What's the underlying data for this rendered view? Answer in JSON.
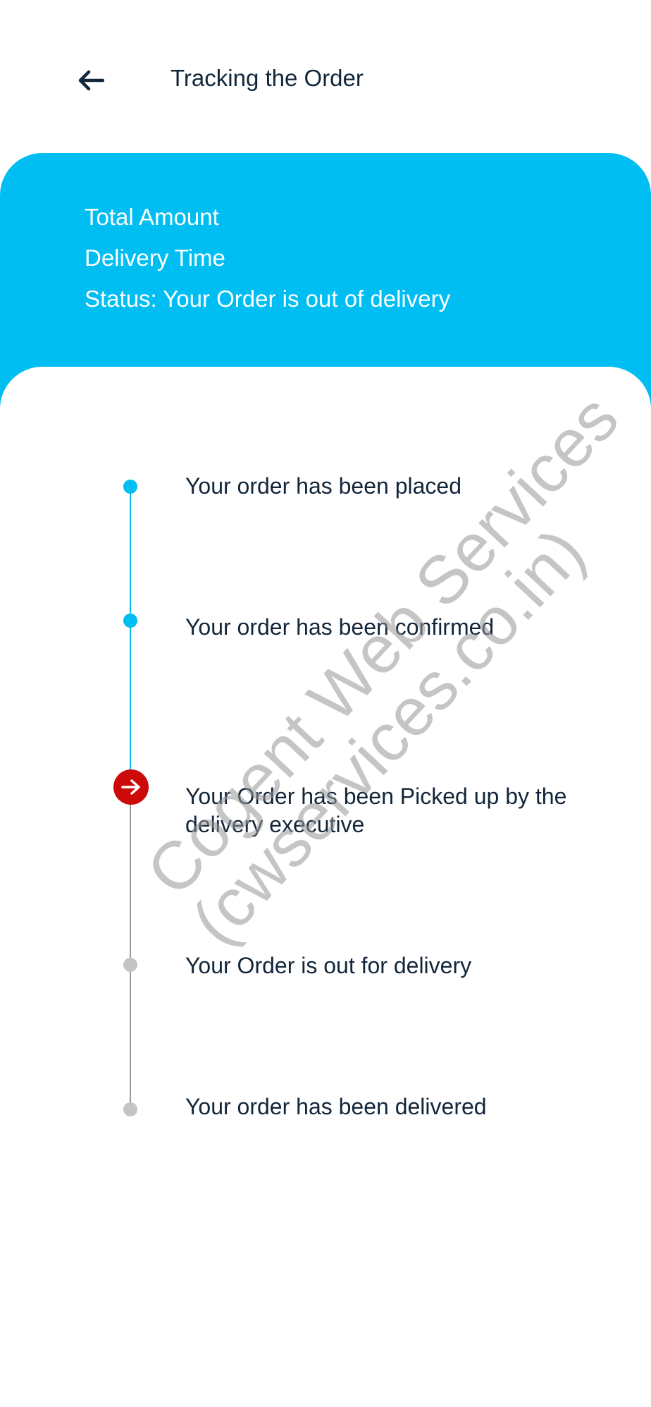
{
  "header": {
    "back_icon": "arrow-left-icon",
    "title": "Tracking the Order"
  },
  "summary": {
    "total_amount_label": "Total Amount",
    "delivery_time_label": "Delivery Time",
    "status_text": "Status: Your Order is out of delivery"
  },
  "timeline": {
    "steps": [
      {
        "label": "Your order has been placed",
        "state": "done"
      },
      {
        "label": "Your order has been confirmed",
        "state": "done"
      },
      {
        "label": "Your Order has been Picked up by the delivery executive",
        "state": "current"
      },
      {
        "label": "Your Order is out for delivery",
        "state": "pending"
      },
      {
        "label": "Your order has been delivered",
        "state": "pending"
      }
    ],
    "current_marker_icon": "arrow-right-icon"
  },
  "watermark": {
    "line1": "Cogent Web Services",
    "line2": "(cwservices.co.in)"
  },
  "colors": {
    "accent": "#00bdf2",
    "current": "#cc0a0a",
    "pending": "#c4c4c4",
    "text": "#12263a"
  }
}
